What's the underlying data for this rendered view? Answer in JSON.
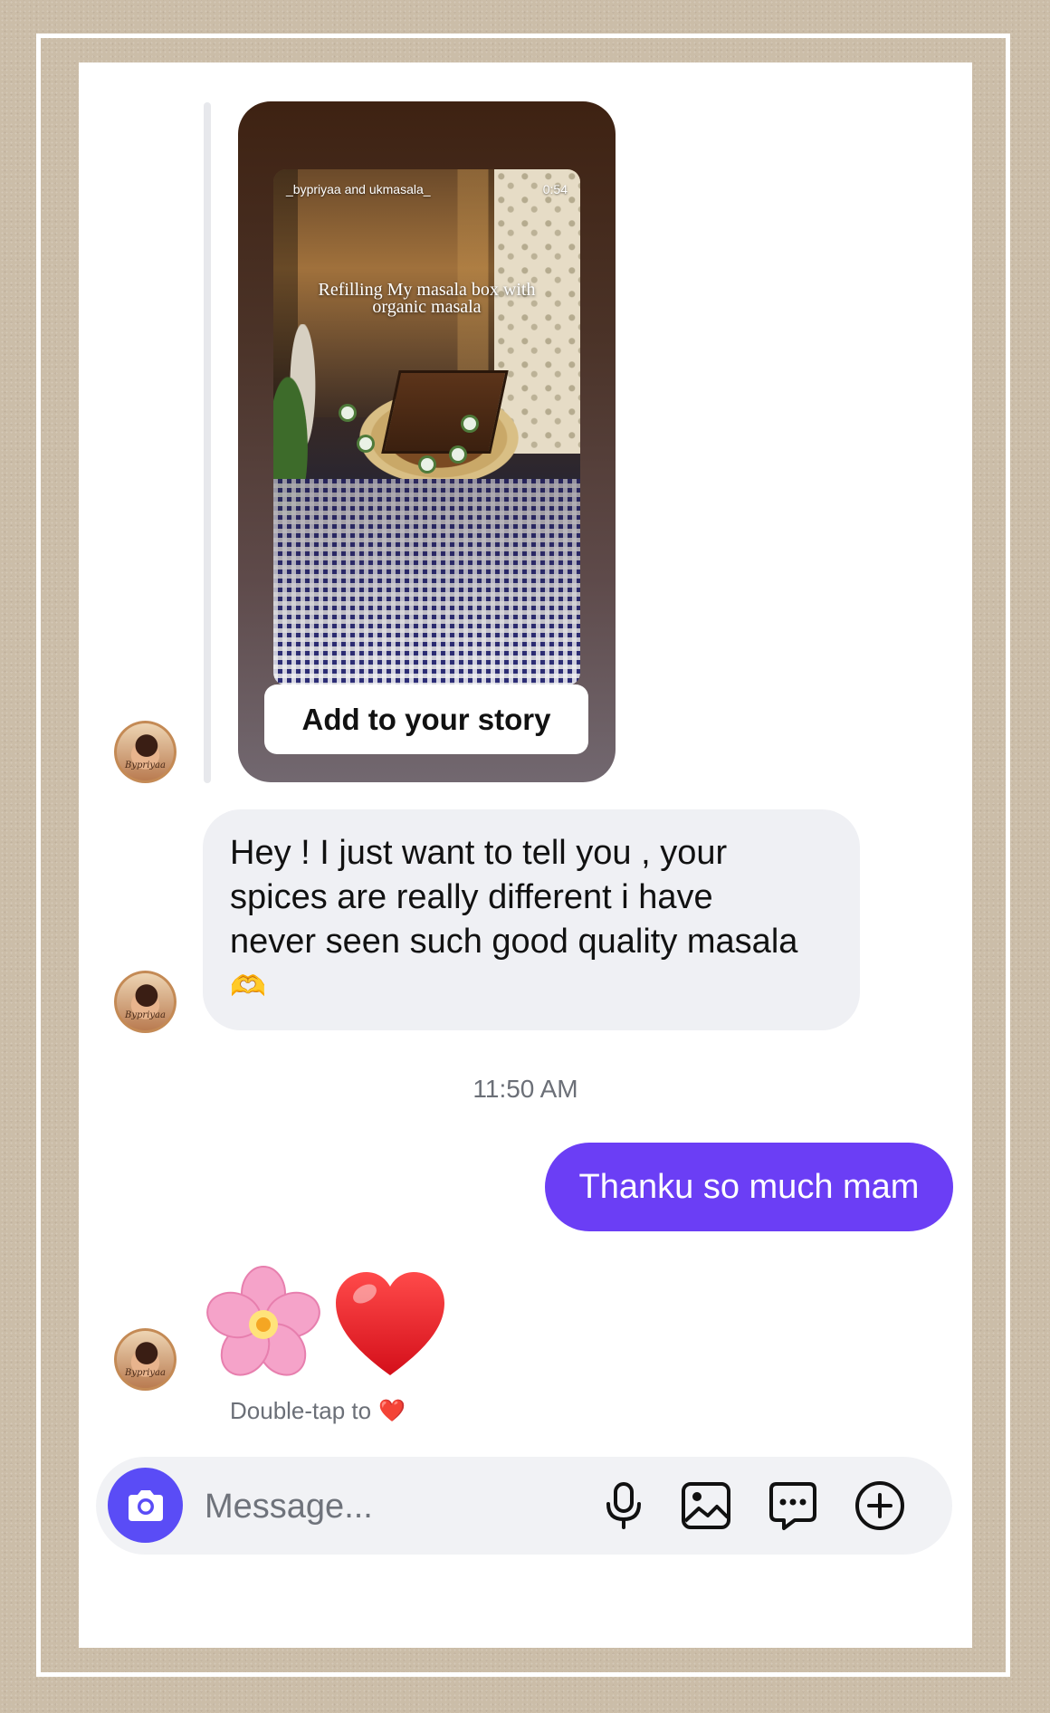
{
  "story": {
    "header": "_bypriyaa and ukmasala_",
    "duration": "0:54",
    "caption_line1": "Refilling My masala box with",
    "caption_line2": "organic masala",
    "add_button": "Add to your story"
  },
  "incoming_message": {
    "line1": "Hey ! I just want to tell you , your",
    "line2": "spices are really different i have",
    "line3": "never seen such good quality masala",
    "emoji": "🫶"
  },
  "timestamp": "11:50 AM",
  "outgoing_message": "Thanku so much mam",
  "reaction_message": {
    "emoji1": "🌸",
    "emoji2": "❤️"
  },
  "hint": {
    "text": "Double-tap to",
    "emoji": "❤️"
  },
  "avatar": {
    "signature": "Bypriyaa"
  },
  "composer": {
    "placeholder": "Message...",
    "icons": [
      "camera-icon",
      "microphone-icon",
      "gallery-icon",
      "sticker-icon",
      "plus-icon"
    ]
  },
  "colors": {
    "outgoing_bubble": "#6b3ef5",
    "camera_button": "#5a4cf6",
    "incoming_bubble": "#eff0f4"
  }
}
